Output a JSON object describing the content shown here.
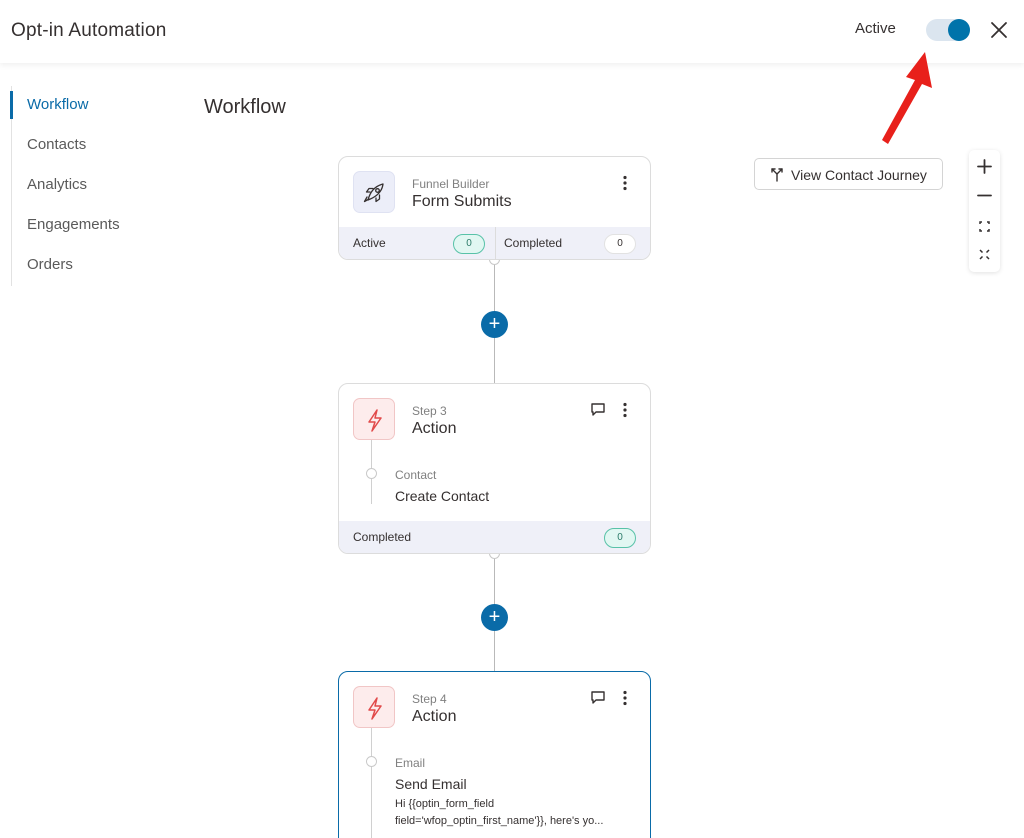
{
  "header": {
    "title": "Opt-in Automation",
    "active_label": "Active",
    "toggle_on": true,
    "accent_color": "#0073aa"
  },
  "sidebar": {
    "items": [
      {
        "label": "Workflow",
        "active": true
      },
      {
        "label": "Contacts",
        "active": false
      },
      {
        "label": "Analytics",
        "active": false
      },
      {
        "label": "Engagements",
        "active": false
      },
      {
        "label": "Orders",
        "active": false
      }
    ]
  },
  "main": {
    "title": "Workflow",
    "view_journey_label": "View Contact Journey",
    "zoom_controls": [
      {
        "name": "zoom-in",
        "glyph": "+"
      },
      {
        "name": "zoom-out",
        "glyph": "−"
      },
      {
        "name": "fit-view",
        "glyph": "fit"
      },
      {
        "name": "fullscreen",
        "glyph": "expand"
      }
    ],
    "trigger": {
      "subtitle": "Funnel Builder",
      "title": "Form Submits",
      "icon": "rocket-icon",
      "active_label": "Active",
      "active_count": "0",
      "completed_label": "Completed",
      "completed_count": "0"
    },
    "step3": {
      "subtitle": "Step 3",
      "title": "Action",
      "icon": "lightning-icon",
      "action_category": "Contact",
      "action_name": "Create Contact",
      "completed_label": "Completed",
      "completed_count": "0"
    },
    "step4": {
      "subtitle": "Step 4",
      "title": "Action",
      "icon": "lightning-icon",
      "action_category": "Email",
      "action_name": "Send Email",
      "preview_line1": "Hi {{optin_form_field",
      "preview_line2": "field='wfop_optin_first_name'}}, here's yo..."
    }
  },
  "colors": {
    "brand_blue": "#0a6ba8",
    "annotation_arrow": "#e8201b",
    "teal_pill": "#58c2a8",
    "action_red": "#e14a4a"
  }
}
